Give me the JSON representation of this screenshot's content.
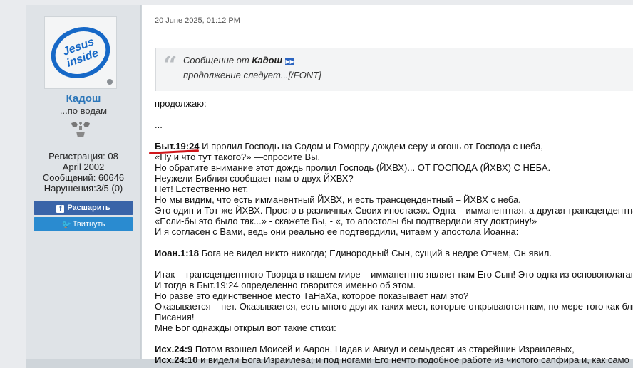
{
  "user": {
    "avatar_text": [
      "Jesus",
      "inside"
    ],
    "name": "Кадош",
    "title": "...по водам",
    "doves_icon": "doves-icon",
    "stats": [
      "Регистрация: 08",
      "April 2002",
      "Сообщений: 60646",
      "Нарушения:3/5 (0)"
    ]
  },
  "buttons": {
    "share": "Расшарить",
    "tweet": "Твитнуть"
  },
  "post": {
    "date": "20 June 2025, 01:12 PM",
    "quote": {
      "prefix": "Сообщение от ",
      "author": "Кадош",
      "body": "продолжение следует...[/FONT]"
    },
    "lines": [
      {
        "t": "продолжаю:"
      },
      {
        "t": ""
      },
      {
        "t": "..."
      },
      {
        "t": ""
      },
      {
        "b": "Быт.19:24",
        "t": " И пролил Господь на Содом и Гоморру дождем серу и огонь от Господа с неба,"
      },
      {
        "t": "«Ну и что тут такого?» —спросите Вы."
      },
      {
        "t": "Но обратите внимание этот дождь пролил Господь (ЙХВХ)... ОТ ГОСПОДА (ЙХВХ) С НЕБА."
      },
      {
        "t": "Неужели Библия сообщает нам о двух ЙХВХ?"
      },
      {
        "t": "Нет! Естественно нет."
      },
      {
        "t": "Но мы видим, что есть имманентный ЙХВХ, и есть трансцендентный – ЙХВХ с неба."
      },
      {
        "t": "Это один и Тот-же ЙХВХ. Просто в различных Своих ипостасях. Одна – имманентная, а другая трансцендентная"
      },
      {
        "t": "«Если-бы это было так...» - скажете Вы, - «, то апостолы бы подтвердили эту доктрину!»"
      },
      {
        "t": "И я согласен с Вами, ведь они реально ее подтвердили, читаем у апостола Иоанна:"
      },
      {
        "t": ""
      },
      {
        "b": "Иоан.1:18",
        "t": " Бога не видел никто никогда; Единородный Сын, сущий в недре Отчем, Он явил."
      },
      {
        "t": ""
      },
      {
        "t": "Итак – трансцендентного Творца в нашем мире – имманентно являет нам Его Сын! Это одна из основополаганцих"
      },
      {
        "t": "И тогда в Быт.19:24 определенно говорится именно об этом."
      },
      {
        "t": "Но разве это единственное место ТаНаХа, которое показывает нам это?"
      },
      {
        "t": "Оказывается – нет. Оказывается, есть много других таких мест, которые открываются нам, по мере того как бли"
      },
      {
        "t": "Писания!"
      },
      {
        "t": "Мне Бог однажды открыл вот такие стихи:"
      },
      {
        "t": ""
      },
      {
        "b": "Исх.24:9",
        "t": " Потом взошел Моисей и Аарон, Надав и Авиуд и семьдесят из старейшин Израилевых,"
      },
      {
        "b": "Исх.24:10",
        "t": " и видели Бога Израилева; и под ногами Его нечто подобное работе из чистого сапфира и, как само"
      }
    ]
  }
}
